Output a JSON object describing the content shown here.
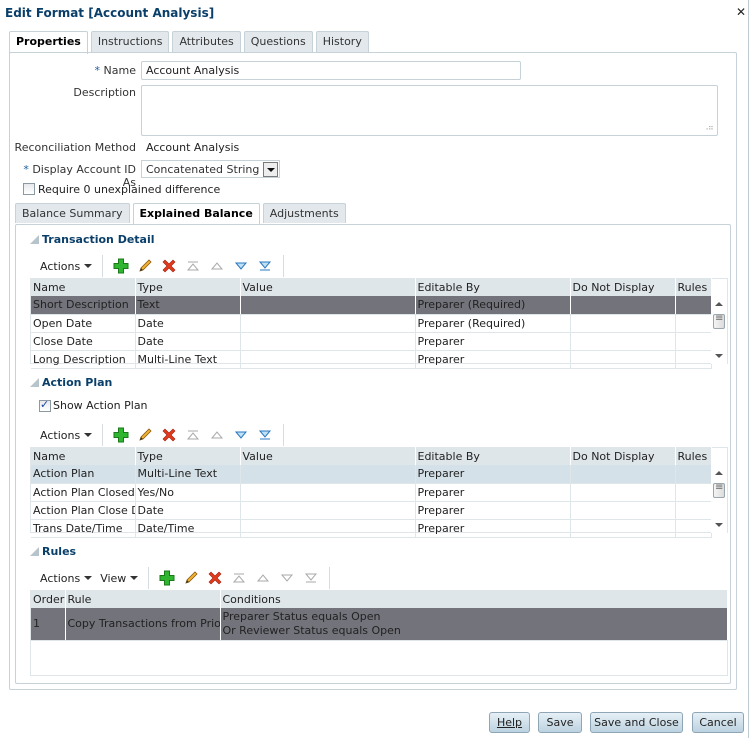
{
  "dialog": {
    "title": "Edit Format [Account Analysis]",
    "close_icon": "close-icon"
  },
  "tabs": [
    {
      "label": "Properties",
      "active": true
    },
    {
      "label": "Instructions",
      "active": false
    },
    {
      "label": "Attributes",
      "active": false
    },
    {
      "label": "Questions",
      "active": false
    },
    {
      "label": "History",
      "active": false
    }
  ],
  "properties": {
    "required_marker": "*",
    "name_label": "Name",
    "name_value": "Account Analysis",
    "description_label": "Description",
    "description_value": "",
    "recon_method_label": "Reconciliation Method",
    "recon_method_value": "Account Analysis",
    "display_id_label": "Display Account ID As",
    "display_id_value": "Concatenated String",
    "require_zero_label": "Require 0 unexplained difference",
    "require_zero_checked": false
  },
  "subtabs": [
    {
      "label": "Balance Summary",
      "active": false
    },
    {
      "label": "Explained Balance",
      "active": true
    },
    {
      "label": "Adjustments",
      "active": false
    }
  ],
  "transaction_detail": {
    "title": "Transaction Detail",
    "toolbar": {
      "actions_label": "Actions"
    },
    "columns": [
      "Name",
      "Type",
      "Value",
      "Editable By",
      "Do Not Display",
      "Rules"
    ],
    "rows": [
      {
        "name": "Short Description",
        "type": "Text",
        "value": "",
        "editable_by": "Preparer (Required)",
        "do_not_display": "",
        "rules": "",
        "selected": true
      },
      {
        "name": "Open Date",
        "type": "Date",
        "value": "",
        "editable_by": "Preparer (Required)",
        "do_not_display": "",
        "rules": ""
      },
      {
        "name": "Close Date",
        "type": "Date",
        "value": "",
        "editable_by": "Preparer",
        "do_not_display": "",
        "rules": ""
      },
      {
        "name": "Long Description",
        "type": "Multi-Line Text",
        "value": "",
        "editable_by": "Preparer",
        "do_not_display": "",
        "rules": ""
      }
    ]
  },
  "action_plan": {
    "title": "Action Plan",
    "show_label": "Show Action Plan",
    "show_checked": true,
    "toolbar": {
      "actions_label": "Actions"
    },
    "columns": [
      "Name",
      "Type",
      "Value",
      "Editable By",
      "Do Not Display",
      "Rules"
    ],
    "rows": [
      {
        "name": "Action Plan",
        "type": "Multi-Line Text",
        "value": "",
        "editable_by": "Preparer",
        "do_not_display": "",
        "rules": "",
        "selected": true
      },
      {
        "name": "Action Plan Closed",
        "type": "Yes/No",
        "value": "",
        "editable_by": "Preparer",
        "do_not_display": "",
        "rules": ""
      },
      {
        "name": "Action Plan Close Dat",
        "type": "Date",
        "value": "",
        "editable_by": "Preparer",
        "do_not_display": "",
        "rules": ""
      },
      {
        "name": "Trans  Date/Time",
        "type": "Date/Time",
        "value": "",
        "editable_by": "Preparer",
        "do_not_display": "",
        "rules": ""
      }
    ]
  },
  "rules": {
    "title": "Rules",
    "toolbar": {
      "actions_label": "Actions",
      "view_label": "View"
    },
    "columns": [
      "Order",
      "Rule",
      "Conditions"
    ],
    "rows": [
      {
        "order": "1",
        "rule": "Copy Transactions from Prior Re",
        "conditions_line1": "Preparer Status equals Open",
        "conditions_line2": "Or Reviewer Status equals Open"
      }
    ]
  },
  "footer": {
    "help": "Help",
    "save": "Save",
    "save_close": "Save and Close",
    "cancel": "Cancel"
  }
}
